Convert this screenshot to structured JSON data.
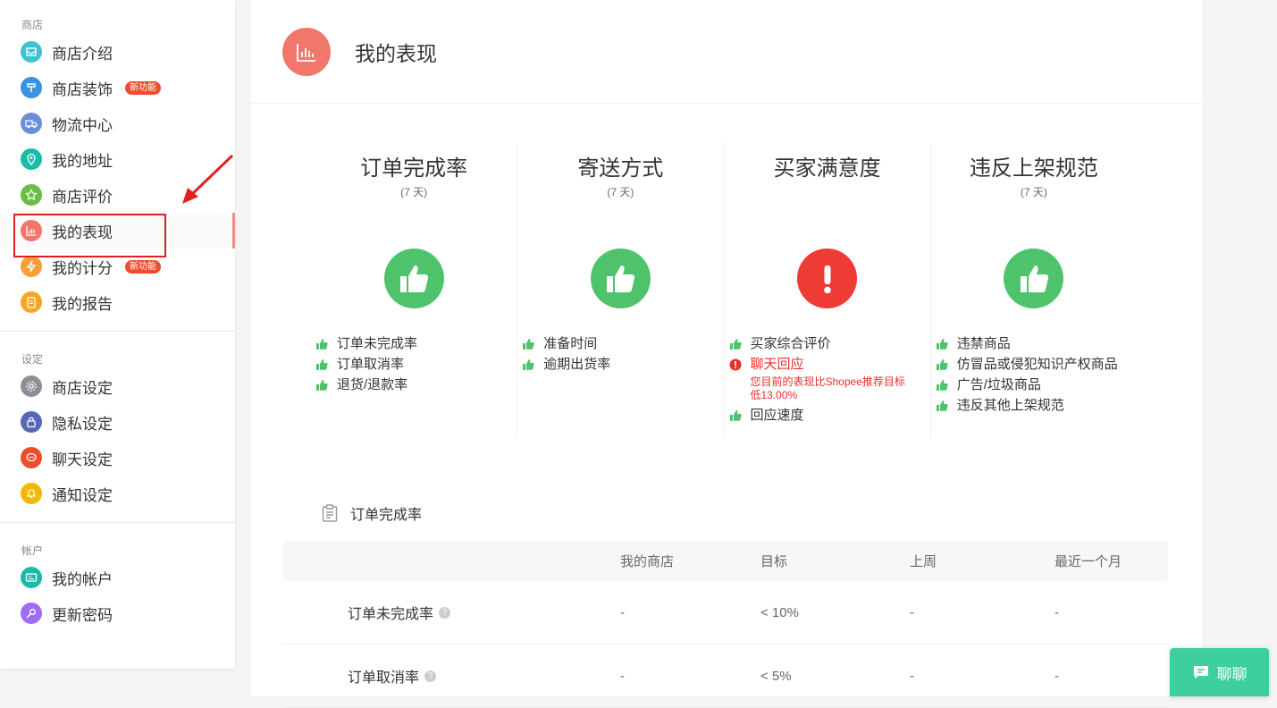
{
  "sidebar": {
    "groups": [
      {
        "title": "商店",
        "items": [
          {
            "label": "商店介绍",
            "icon": "storefront-icon",
            "color": "#3fc1d4"
          },
          {
            "label": "商店装饰",
            "icon": "brush-icon",
            "color": "#3a93e0",
            "badge": "新功能"
          },
          {
            "label": "物流中心",
            "icon": "truck-icon",
            "color": "#6a8fd6"
          },
          {
            "label": "我的地址",
            "icon": "location-pin-icon",
            "color": "#1bbba7"
          },
          {
            "label": "商店评价",
            "icon": "star-icon",
            "color": "#6cbd45"
          },
          {
            "label": "我的表现",
            "icon": "bar-chart-icon",
            "color": "#f0776a",
            "active": true
          },
          {
            "label": "我的计分",
            "icon": "lightning-icon",
            "color": "#f5a03a",
            "badge": "新功能"
          },
          {
            "label": "我的报告",
            "icon": "clipboard-icon",
            "color": "#f5a623"
          }
        ]
      },
      {
        "title": "设定",
        "items": [
          {
            "label": "商店设定",
            "icon": "gear-icon",
            "color": "#8c9096"
          },
          {
            "label": "隐私设定",
            "icon": "lock-icon",
            "color": "#5a67b5"
          },
          {
            "label": "聊天设定",
            "icon": "chat-icon",
            "color": "#ef4b2d"
          },
          {
            "label": "通知设定",
            "icon": "bell-icon",
            "color": "#f5b800"
          }
        ]
      },
      {
        "title": "帐户",
        "items": [
          {
            "label": "我的帐户",
            "icon": "id-card-icon",
            "color": "#1bbba7"
          },
          {
            "label": "更新密码",
            "icon": "key-icon",
            "color": "#9f6ef0"
          }
        ]
      }
    ]
  },
  "header": {
    "title": "我的表现",
    "icon": "bar-chart-icon",
    "icon_color": "#f0776a"
  },
  "metrics": [
    {
      "title": "订单完成率",
      "period": "(7 天)",
      "status": "good",
      "items": [
        {
          "text": "订单未完成率",
          "ok": true
        },
        {
          "text": "订单取消率",
          "ok": true
        },
        {
          "text": "退货/退款率",
          "ok": true
        }
      ]
    },
    {
      "title": "寄送方式",
      "period": "(7 天)",
      "status": "good",
      "items": [
        {
          "text": "准备时间",
          "ok": true
        },
        {
          "text": "逾期出货率",
          "ok": true
        }
      ]
    },
    {
      "title": "买家满意度",
      "period": "",
      "status": "bad",
      "items": [
        {
          "text": "买家综合评价",
          "ok": true
        },
        {
          "text": "聊天回应",
          "ok": false,
          "note": "您目前的表现比Shopee推荐目标低13.00%"
        },
        {
          "text": "回应速度",
          "ok": true
        }
      ]
    },
    {
      "title": "违反上架规范",
      "period": "(7 天)",
      "status": "good",
      "items": [
        {
          "text": "违禁商品",
          "ok": true
        },
        {
          "text": "仿冒品或侵犯知识产权商品",
          "ok": true
        },
        {
          "text": "广告/垃圾商品",
          "ok": true
        },
        {
          "text": "违反其他上架规范",
          "ok": true
        }
      ]
    }
  ],
  "section": {
    "title": "订单完成率",
    "icon": "clipboard-icon"
  },
  "table": {
    "headers": [
      "",
      "我的商店",
      "目标",
      "上周",
      "最近一个月"
    ],
    "rows": [
      {
        "name": "订单未完成率",
        "help": "?",
        "mine": "-",
        "target": "< 10%",
        "last_week": "-",
        "last_month": "-"
      },
      {
        "name": "订单取消率",
        "help": "?",
        "mine": "-",
        "target": "< 5%",
        "last_week": "-",
        "last_month": "-"
      }
    ]
  },
  "chat_button": {
    "label": "聊聊",
    "icon": "chat-bubble-icon",
    "color": "#3ecf9e"
  },
  "colors": {
    "good": "#4fc36b",
    "bad": "#ef3b36",
    "accent": "#ee4d2d",
    "annotation": "#e02020"
  }
}
